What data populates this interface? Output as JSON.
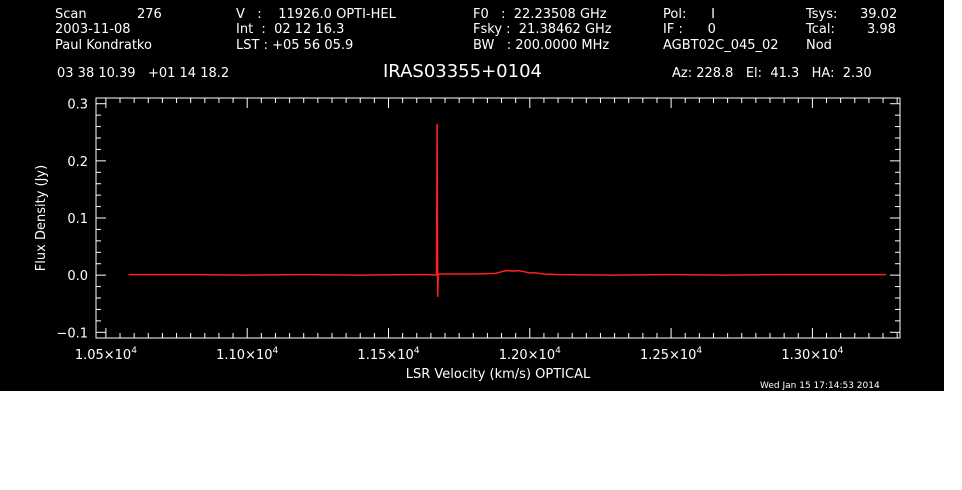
{
  "header": {
    "col1": {
      "scan_label": "Scan",
      "scan_value": "276",
      "date": "2003-11-08",
      "observer": "Paul Kondratko"
    },
    "col2": {
      "v": "V   :    11926.0 OPTI-HEL",
      "int": "Int  :  02 12 16.3",
      "lst": "LST : +05 56 05.9"
    },
    "col3": {
      "f0": "F0   :  22.23508 GHz",
      "fsky": "Fsky :  21.38462 GHz",
      "bw": "BW   : 200.0000 MHz"
    },
    "col4": {
      "pol": "Pol:      I",
      "if": "IF :      0",
      "project": "AGBT02C_045_02"
    },
    "col5": {
      "tsys_label": "Tsys:",
      "tsys_value": "39.02",
      "tcal_label": "Tcal:",
      "tcal_value": "3.98",
      "mode": "Nod"
    },
    "coords": "03 38 10.39   +01 14 18.2",
    "source": "IRAS03355+0104",
    "azelha": "Az: 228.8   El:  41.3   HA:  2.30"
  },
  "timestamp": "Wed Jan 15 17:14:53 2014",
  "colors": {
    "background": "#000000",
    "axes": "#ffffff",
    "trace": "#ff2020"
  },
  "chart_data": {
    "type": "line",
    "title": "IRAS03355+0104",
    "xlabel": "LSR Velocity (km/s) OPTICAL",
    "ylabel": "Flux Density (Jy)",
    "xlim": [
      10465,
      13310
    ],
    "ylim": [
      -0.11,
      0.31
    ],
    "xticks": [
      {
        "value": 10500,
        "mant": "1.05",
        "exp": "4"
      },
      {
        "value": 11000,
        "mant": "1.10",
        "exp": "4"
      },
      {
        "value": 11500,
        "mant": "1.15",
        "exp": "4"
      },
      {
        "value": 12000,
        "mant": "1.20",
        "exp": "4"
      },
      {
        "value": 12500,
        "mant": "1.25",
        "exp": "4"
      },
      {
        "value": 13000,
        "mant": "1.30",
        "exp": "4"
      }
    ],
    "yticks": [
      {
        "value": -0.1,
        "label": "−0.1"
      },
      {
        "value": 0.0,
        "label": "0.0"
      },
      {
        "value": 0.1,
        "label": "0.1"
      },
      {
        "value": 0.2,
        "label": "0.2"
      },
      {
        "value": 0.3,
        "label": "0.3"
      }
    ],
    "grid": false,
    "series": [
      {
        "x": [
          10580,
          10800,
          11000,
          11200,
          11400,
          11600,
          11640,
          11670,
          11672,
          11674,
          11676,
          11678,
          11700,
          11800,
          11880,
          11900,
          11920,
          11940,
          11960,
          11980,
          12000,
          12020,
          12050,
          12100,
          12300,
          12500,
          12700,
          12900,
          13100,
          13260
        ],
        "y": [
          0.001,
          0.001,
          0.0,
          0.001,
          0.0,
          0.001,
          0.001,
          0.0,
          0.265,
          -0.038,
          0.0,
          0.002,
          0.002,
          0.002,
          0.003,
          0.006,
          0.008,
          0.007,
          0.008,
          0.006,
          0.004,
          0.004,
          0.002,
          0.001,
          0.0,
          0.001,
          0.0,
          0.001,
          0.001,
          0.001
        ]
      }
    ]
  }
}
